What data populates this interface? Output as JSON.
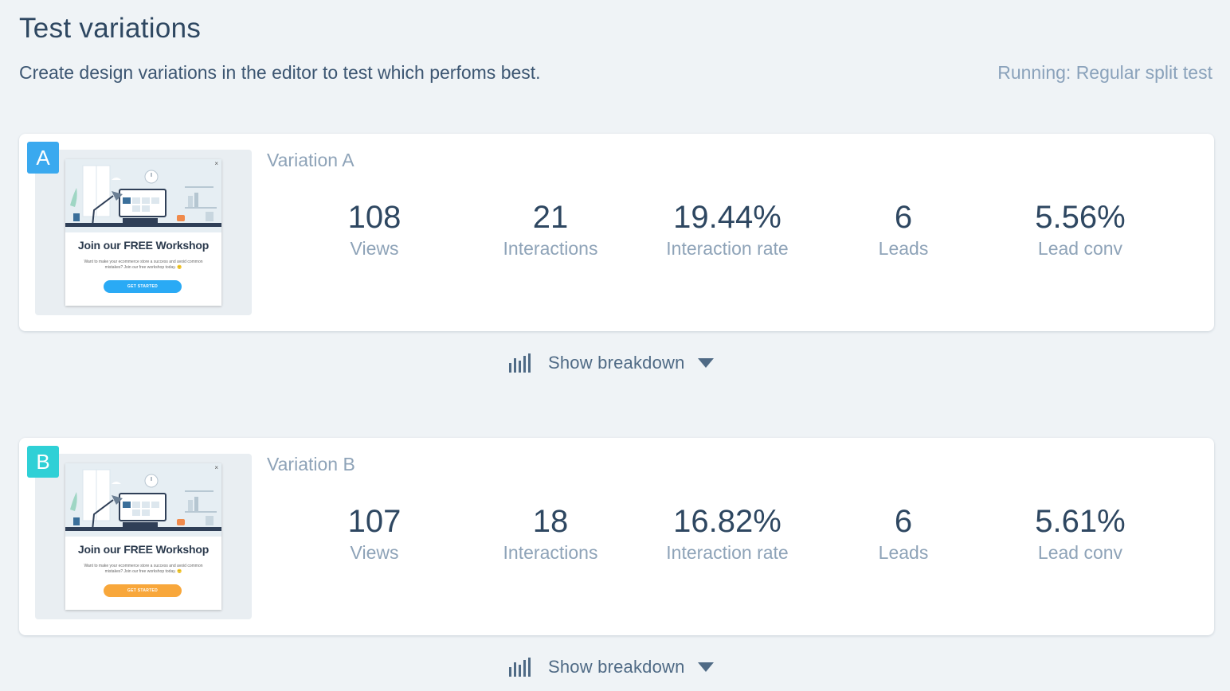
{
  "header": {
    "title": "Test variations",
    "description": "Create design variations in the editor to test which perfoms best.",
    "running": "Running: Regular split test"
  },
  "colors": {
    "badge_a": "#3aa9ef",
    "badge_b": "#2fd0d6",
    "cta_a": "#2aaaf5",
    "cta_b": "#f8a73b"
  },
  "variations": [
    {
      "badge": "A",
      "name": "Variation A",
      "preview": {
        "close": "×",
        "title": "Join our FREE Workshop",
        "body": "Want to make your ecommerce store a success and avoid common mistakes? Join our free workshop today. 🙂",
        "cta": "GET STARTED"
      },
      "stats": [
        {
          "value": "108",
          "label": "Views"
        },
        {
          "value": "21",
          "label": "Interactions"
        },
        {
          "value": "19.44%",
          "label": "Interaction rate"
        },
        {
          "value": "6",
          "label": "Leads"
        },
        {
          "value": "5.56%",
          "label": "Lead conv"
        }
      ],
      "breakdown_label": "Show breakdown"
    },
    {
      "badge": "B",
      "name": "Variation B",
      "preview": {
        "close": "×",
        "title": "Join our FREE Workshop",
        "body": "Want to make your ecommerce store a success and avoid common mistakes? Join our free workshop today. 🙂",
        "cta": "GET STARTED"
      },
      "stats": [
        {
          "value": "107",
          "label": "Views"
        },
        {
          "value": "18",
          "label": "Interactions"
        },
        {
          "value": "16.82%",
          "label": "Interaction rate"
        },
        {
          "value": "6",
          "label": "Leads"
        },
        {
          "value": "5.61%",
          "label": "Lead conv"
        }
      ],
      "breakdown_label": "Show breakdown"
    }
  ],
  "icons": {
    "breakdown": "bar-chart-icon",
    "caret": "caret-down-icon"
  }
}
